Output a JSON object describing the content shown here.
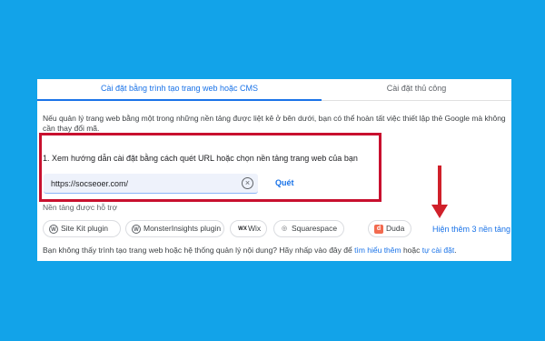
{
  "tabs": {
    "cms": "Cài đặt bằng trình tạo trang web hoặc CMS",
    "manual": "Cài đặt thủ công"
  },
  "intro": "Nếu quản lý trang web bằng một trong những nền tảng được liệt kê ở bên dưới, bạn có thể hoàn tất việc thiết lập thẻ Google mà không cần thay đổi mã.",
  "step": {
    "text": "1. Xem hướng dẫn cài đặt bằng cách quét URL hoặc chọn nền tảng trang web của bạn",
    "url_value": "https://socseoer.com/",
    "clear_icon": "⊗",
    "scan_label": "Quét"
  },
  "supported_label": "Nền tảng được hỗ trợ",
  "platforms": [
    {
      "name": "Site Kit plugin",
      "icon": "wordpress-icon"
    },
    {
      "name": "MonsterInsights plugin",
      "icon": "wordpress-icon"
    },
    {
      "name": "Wix",
      "icon": "wix-icon"
    },
    {
      "name": "Squarespace",
      "icon": "squarespace-icon"
    },
    {
      "name": "Duda",
      "icon": "duda-icon"
    }
  ],
  "show_more": "Hiện thêm 3 nền tảng",
  "footer": {
    "prefix": "Bạn không thấy trình tạo trang web hoặc hệ thống quản lý nội dung? Hãy nhấp vào đây để ",
    "learn_more": "tìm hiểu thêm",
    "middle": " hoặc ",
    "manual_link": "tự cài đặt",
    "suffix": "."
  },
  "colors": {
    "background": "#12a3e9",
    "accent": "#1a73e8",
    "highlight": "#c8102e",
    "arrow": "#d0202a"
  }
}
